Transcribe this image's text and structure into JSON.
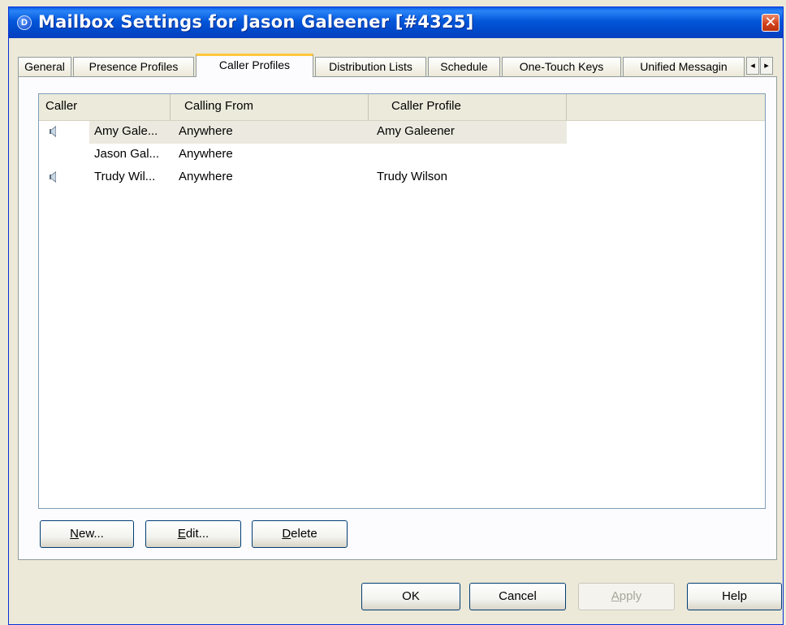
{
  "window": {
    "title": "Mailbox Settings for Jason Galeener [#4325]",
    "icon_letter": "D",
    "close_glyph": "✕"
  },
  "tabs": [
    {
      "label": "General"
    },
    {
      "label": "Presence Profiles"
    },
    {
      "label": "Caller Profiles",
      "active": true
    },
    {
      "label": "Distribution Lists"
    },
    {
      "label": "Schedule"
    },
    {
      "label": "One-Touch Keys"
    },
    {
      "label": "Unified Messagin"
    }
  ],
  "tab_scroll": {
    "left": "◂",
    "right": "▸"
  },
  "list": {
    "columns": [
      "Caller",
      "Calling From",
      "Caller Profile"
    ],
    "rows": [
      {
        "caller": "Amy Gale...",
        "calling_from": "Anywhere",
        "profile": "Amy Galeener",
        "icon": "speaker-icon",
        "selected": true
      },
      {
        "caller": "Jason Gal...",
        "calling_from": "Anywhere",
        "profile": "",
        "icon": ""
      },
      {
        "caller": "Trudy Wil...",
        "calling_from": "Anywhere",
        "profile": "Trudy Wilson",
        "icon": "speaker-icon"
      }
    ]
  },
  "panel_buttons": {
    "new": {
      "pre": "",
      "key": "N",
      "post": "ew..."
    },
    "edit": {
      "pre": "",
      "key": "E",
      "post": "dit..."
    },
    "delete": {
      "pre": "",
      "key": "D",
      "post": "elete"
    }
  },
  "dialog_buttons": {
    "ok": "OK",
    "cancel": "Cancel",
    "apply": {
      "key": "A",
      "post": "pply"
    },
    "help": "Help"
  }
}
